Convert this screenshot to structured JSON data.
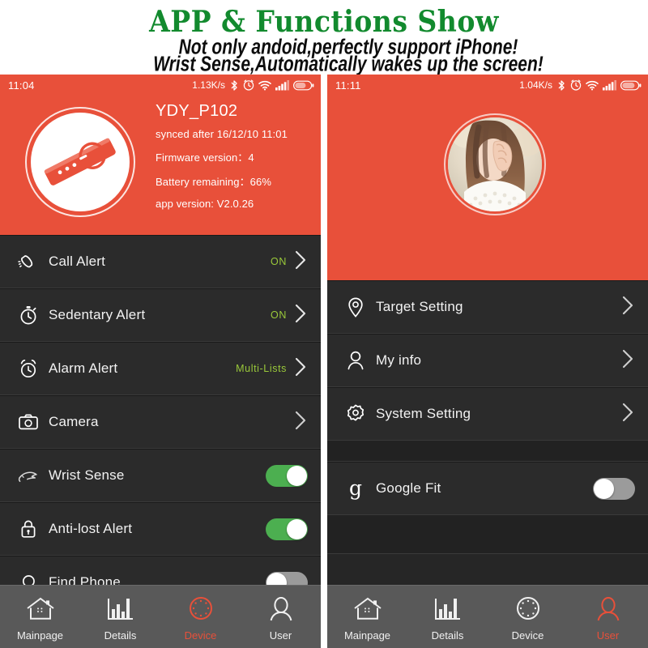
{
  "banner": {
    "title": "APP & Functions Show",
    "line1": "Not only andoid,perfectly support iPhone!",
    "line2": "Wrist Sense,Automatically wakes up the screen!"
  },
  "colors": {
    "accent_red": "#e8503a",
    "toggle_on_green": "#4caf50",
    "value_green": "#9ac93a",
    "list_bg": "#2b2b2b",
    "nav_bg": "#595959"
  },
  "left_phone": {
    "statusbar": {
      "time": "11:04",
      "data_rate": "1.13K/s",
      "icons": [
        "bluetooth-icon",
        "alarm-icon",
        "wifi-icon",
        "signal-icon",
        "battery-icon"
      ]
    },
    "header": {
      "device_image": "wristband-icon",
      "device_name": "YDY_P102",
      "synced": "synced after 16/12/10 11:01",
      "firmware": "Firmware version：4",
      "battery": "Battery remaining：66%",
      "app_version": "app version: V2.0.26"
    },
    "rows": [
      {
        "icon": "call-alert-icon",
        "label": "Call Alert",
        "value": "ON",
        "control": "chevron"
      },
      {
        "icon": "stopwatch-icon",
        "label": "Sedentary Alert",
        "value": "ON",
        "control": "chevron"
      },
      {
        "icon": "alarm-clock-icon",
        "label": "Alarm Alert",
        "value": "Multi-Lists",
        "control": "chevron"
      },
      {
        "icon": "camera-icon",
        "label": "Camera",
        "value": "",
        "control": "chevron"
      },
      {
        "icon": "wrist-sense-icon",
        "label": "Wrist Sense",
        "value": "",
        "control": "toggle",
        "state": "on"
      },
      {
        "icon": "lock-icon",
        "label": "Anti-lost Alert",
        "value": "",
        "control": "toggle",
        "state": "on"
      },
      {
        "icon": "search-icon",
        "label": "Find Phone",
        "value": "",
        "control": "toggle",
        "state": "off"
      }
    ],
    "nav": [
      {
        "icon": "home-icon",
        "label": "Mainpage",
        "active": false
      },
      {
        "icon": "chart-icon",
        "label": "Details",
        "active": false
      },
      {
        "icon": "device-icon",
        "label": "Device",
        "active": true
      },
      {
        "icon": "user-icon",
        "label": "User",
        "active": false
      }
    ]
  },
  "right_phone": {
    "statusbar": {
      "time": "11:11",
      "data_rate": "1.04K/s",
      "icons": [
        "bluetooth-icon",
        "alarm-icon",
        "wifi-icon",
        "signal-icon",
        "battery-icon"
      ]
    },
    "header": {
      "avatar": "user-photo-avatar"
    },
    "rows": [
      {
        "icon": "location-pin-icon",
        "label": "Target Setting",
        "value": "",
        "control": "chevron"
      },
      {
        "icon": "person-icon",
        "label": "My info",
        "value": "",
        "control": "chevron"
      },
      {
        "icon": "gear-icon",
        "label": "System Setting",
        "value": "",
        "control": "chevron"
      },
      {
        "icon": "google-fit-icon",
        "label": "Google Fit",
        "value": "",
        "control": "toggle",
        "state": "off"
      }
    ],
    "nav": [
      {
        "icon": "home-icon",
        "label": "Mainpage",
        "active": false
      },
      {
        "icon": "chart-icon",
        "label": "Details",
        "active": false
      },
      {
        "icon": "device-icon",
        "label": "Device",
        "active": false
      },
      {
        "icon": "user-icon",
        "label": "User",
        "active": true
      }
    ]
  }
}
